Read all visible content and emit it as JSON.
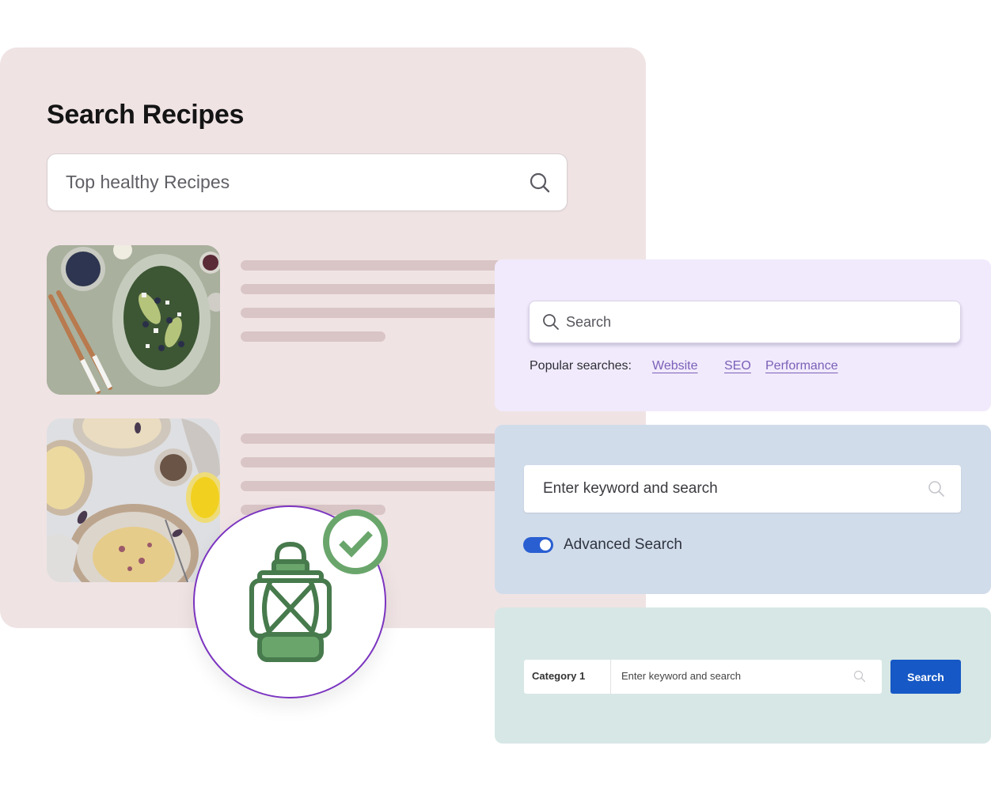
{
  "recipes": {
    "title": "Search Recipes",
    "search_value": "Top healthy Recipes",
    "items": [
      {
        "image": "salad-photo",
        "skeleton_lines": 4
      },
      {
        "image": "pasta-photo",
        "skeleton_lines": 4
      }
    ]
  },
  "badge": {
    "icon": "lantern-icon",
    "status_icon": "check-circle-icon"
  },
  "purple_widget": {
    "placeholder": "Search",
    "popular_label": "Popular searches:",
    "popular_links": [
      "Website",
      "SEO",
      "Performance"
    ],
    "link_color": "#7a60b8"
  },
  "blue_widget": {
    "placeholder": "Enter keyword and search",
    "toggle_label": "Advanced Search",
    "toggle_on": true,
    "toggle_color": "#2a5fd2"
  },
  "green_widget": {
    "category": "Category 1",
    "placeholder": "Enter keyword and search",
    "button_label": "Search",
    "button_color": "#1658c5"
  }
}
